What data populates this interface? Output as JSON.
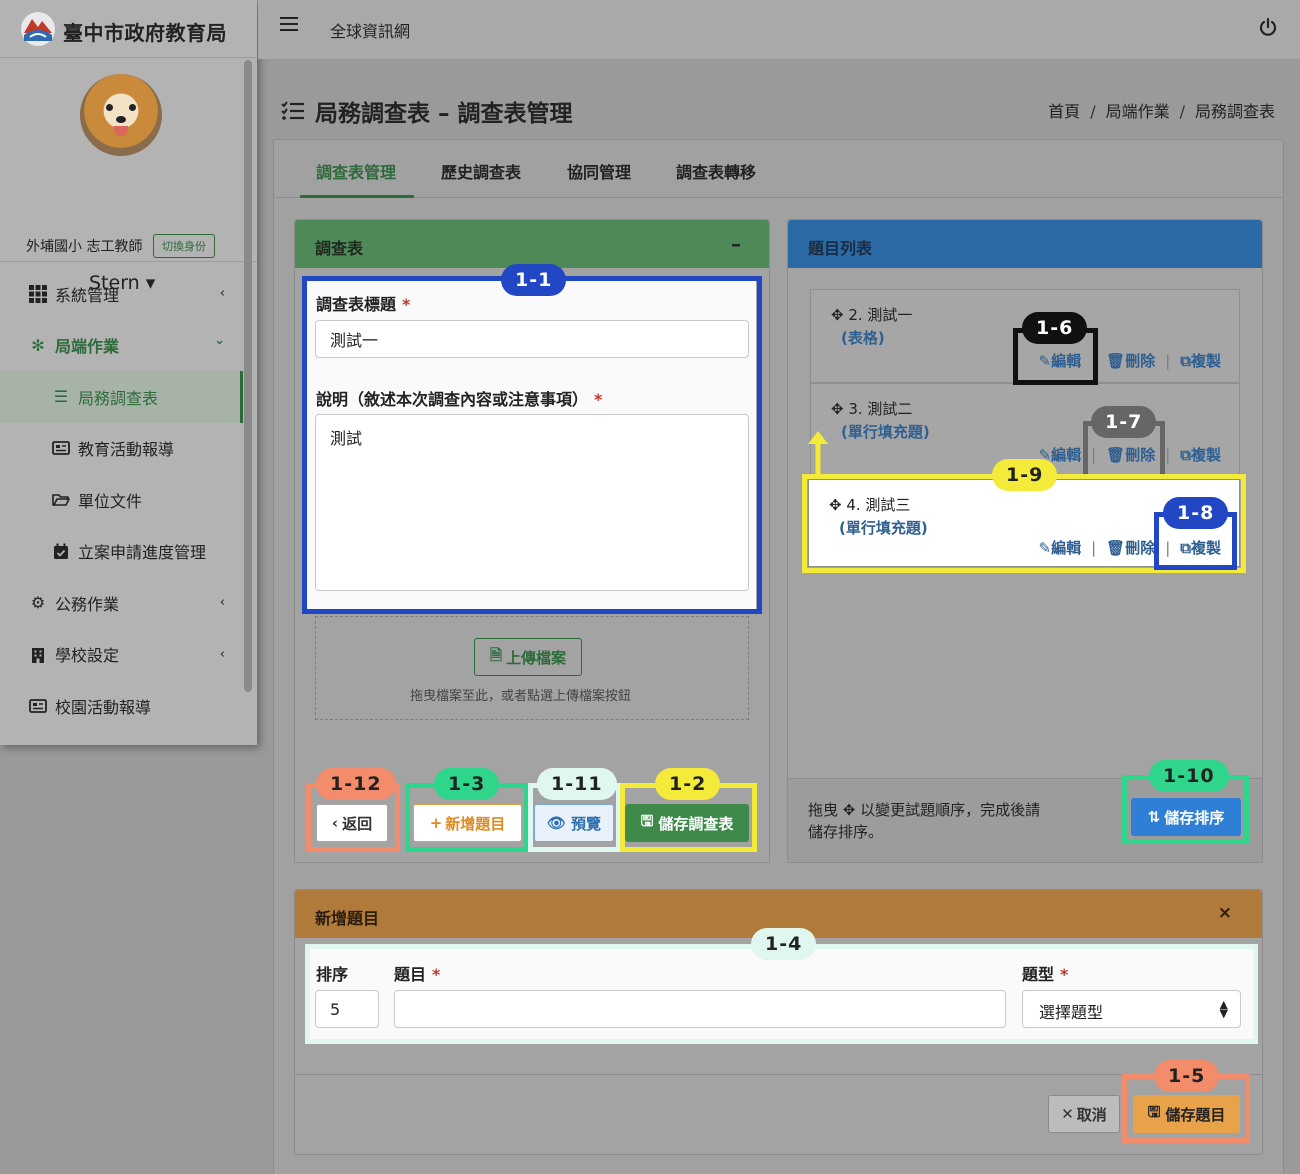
{
  "brand": {
    "name": "臺中市政府教育局"
  },
  "topbar": {
    "site_link": "全球資訊網"
  },
  "profile": {
    "role": "外埔國小 志工教師",
    "switch_label": "切換身份",
    "username": "Stern ▾"
  },
  "sidebar": {
    "items": [
      {
        "label": "系統管理",
        "icon": "grid-icon",
        "chevron": "‹"
      },
      {
        "label": "局端作業",
        "icon": "gear-flower-icon",
        "chevron": "⌄"
      },
      {
        "label": "局務調查表",
        "icon": "list-icon"
      },
      {
        "label": "教育活動報導",
        "icon": "newspaper-icon"
      },
      {
        "label": "單位文件",
        "icon": "folder-icon"
      },
      {
        "label": "立案申請進度管理",
        "icon": "calendar-check-icon"
      },
      {
        "label": "公務作業",
        "icon": "gears-icon",
        "chevron": "‹"
      },
      {
        "label": "學校設定",
        "icon": "building-icon",
        "chevron": "‹"
      },
      {
        "label": "校園活動報導",
        "icon": "newspaper-icon"
      }
    ]
  },
  "page": {
    "title": "局務調查表 – 調查表管理",
    "breadcrumb": [
      "首頁",
      "局端作業",
      "局務調查表"
    ]
  },
  "tabs": [
    "調查表管理",
    "歷史調查表",
    "協同管理",
    "調查表轉移"
  ],
  "survey_panel": {
    "title": "調查表",
    "collapse": "–",
    "title_label": "調查表標題",
    "title_value": "測試一",
    "desc_label": "說明（敘述本次調查內容或注意事項）",
    "desc_value": "測試",
    "upload_label": "上傳檔案",
    "drop_hint": "拖曳檔案至此，或者點選上傳檔案按鈕",
    "back_label": "返回",
    "add_label": "新增題目",
    "preview_label": "預覽",
    "save_label": "儲存調查表"
  },
  "question_panel": {
    "title": "題目列表",
    "questions": [
      {
        "title": "2. 測試一",
        "type": "(表格)"
      },
      {
        "title": "3. 測試二",
        "type": "(單行填充題)"
      },
      {
        "title": "4. 測試三",
        "type": "(單行填充題)"
      }
    ],
    "edit_label": "編輯",
    "delete_label": "刪除",
    "copy_label": "複製",
    "footer_hint": "拖曳 ✥ 以變更試題順序，完成後請儲存排序。",
    "save_order_label": "儲存排序"
  },
  "add_panel": {
    "title": "新增題目",
    "close": "×",
    "order_label": "排序",
    "order_value": "5",
    "question_label": "題目",
    "question_value": "",
    "type_label": "題型",
    "type_value": "選擇題型",
    "cancel_label": "取消",
    "save_label": "儲存題目"
  },
  "annotations": [
    "1-1",
    "1-2",
    "1-3",
    "1-4",
    "1-5",
    "1-6",
    "1-7",
    "1-8",
    "1-9",
    "1-10",
    "1-11",
    "1-12"
  ],
  "colors": {
    "survey_header": "#4e8a57",
    "question_header": "#2c6aa6",
    "add_header": "#b07a3a",
    "accent_green": "#2d6b3b",
    "anno_blue": "#2247c5",
    "anno_yellow": "#f4ea3a",
    "anno_green": "#2fd58a",
    "anno_salmon": "#f28c6a"
  }
}
